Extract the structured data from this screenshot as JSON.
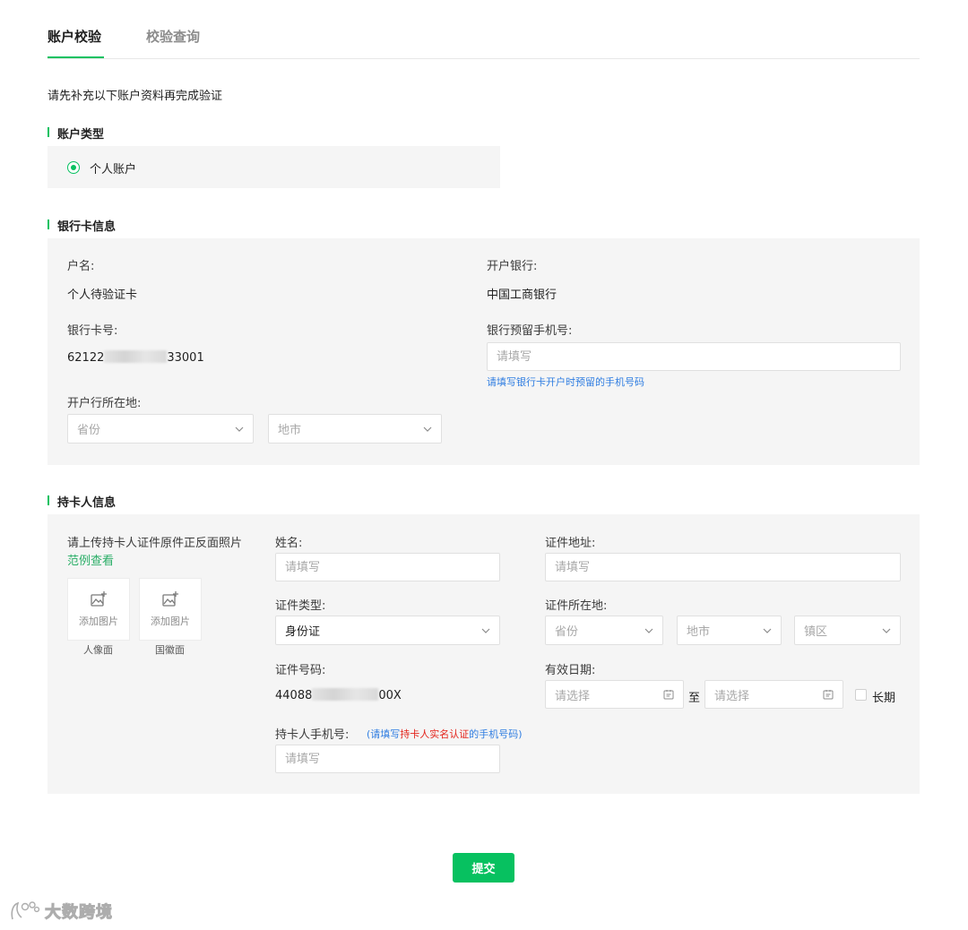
{
  "tabs": [
    {
      "label": "账户校验",
      "active": true
    },
    {
      "label": "校验查询",
      "active": false
    }
  ],
  "intro": "请先补充以下账户资料再完成验证",
  "account_type": {
    "title": "账户类型",
    "option": "个人账户"
  },
  "bank_info": {
    "title": "银行卡信息",
    "holder_label": "户名:",
    "holder_value": "个人待验证卡",
    "bank_label": "开户银行:",
    "bank_value": "中国工商银行",
    "card_label": "银行卡号:",
    "card_prefix": "62122",
    "card_suffix": "33001",
    "phone_label": "银行预留手机号:",
    "phone_placeholder": "请填写",
    "phone_hint": "请填写银行卡开户时预留的手机号码",
    "location_label": "开户行所在地:",
    "province_placeholder": "省份",
    "city_placeholder": "地市"
  },
  "holder_info": {
    "title": "持卡人信息",
    "upload_instruction": "请上传持卡人证件原件正反面照片",
    "example_link": "范例查看",
    "upload_text": "添加图片",
    "portrait_label": "人像面",
    "emblem_label": "国徽面",
    "name_label": "姓名:",
    "name_placeholder": "请填写",
    "address_label": "证件地址:",
    "address_placeholder": "请填写",
    "id_type_label": "证件类型:",
    "id_type_value": "身份证",
    "id_location_label": "证件所在地:",
    "id_province_placeholder": "省份",
    "id_city_placeholder": "地市",
    "id_district_placeholder": "镇区",
    "id_number_label": "证件号码:",
    "id_number_prefix": "44088",
    "id_number_suffix": "00X",
    "valid_label": "有效日期:",
    "start_placeholder": "请选择",
    "to_text": "至",
    "end_placeholder": "请选择",
    "long_term_label": "长期",
    "phone_label": "持卡人手机号:",
    "phone_hint_pre": "(请填写",
    "phone_hint_red": "持卡人实名认证",
    "phone_hint_post": "的手机号码)",
    "phone_placeholder": "请填写"
  },
  "submit_label": "提交",
  "watermark_text": "大数跨境",
  "colors": {
    "accent": "#07c160",
    "hint_blue": "#2f7de1",
    "hint_red": "#e3231b",
    "panel_bg": "#f5f5f5"
  }
}
